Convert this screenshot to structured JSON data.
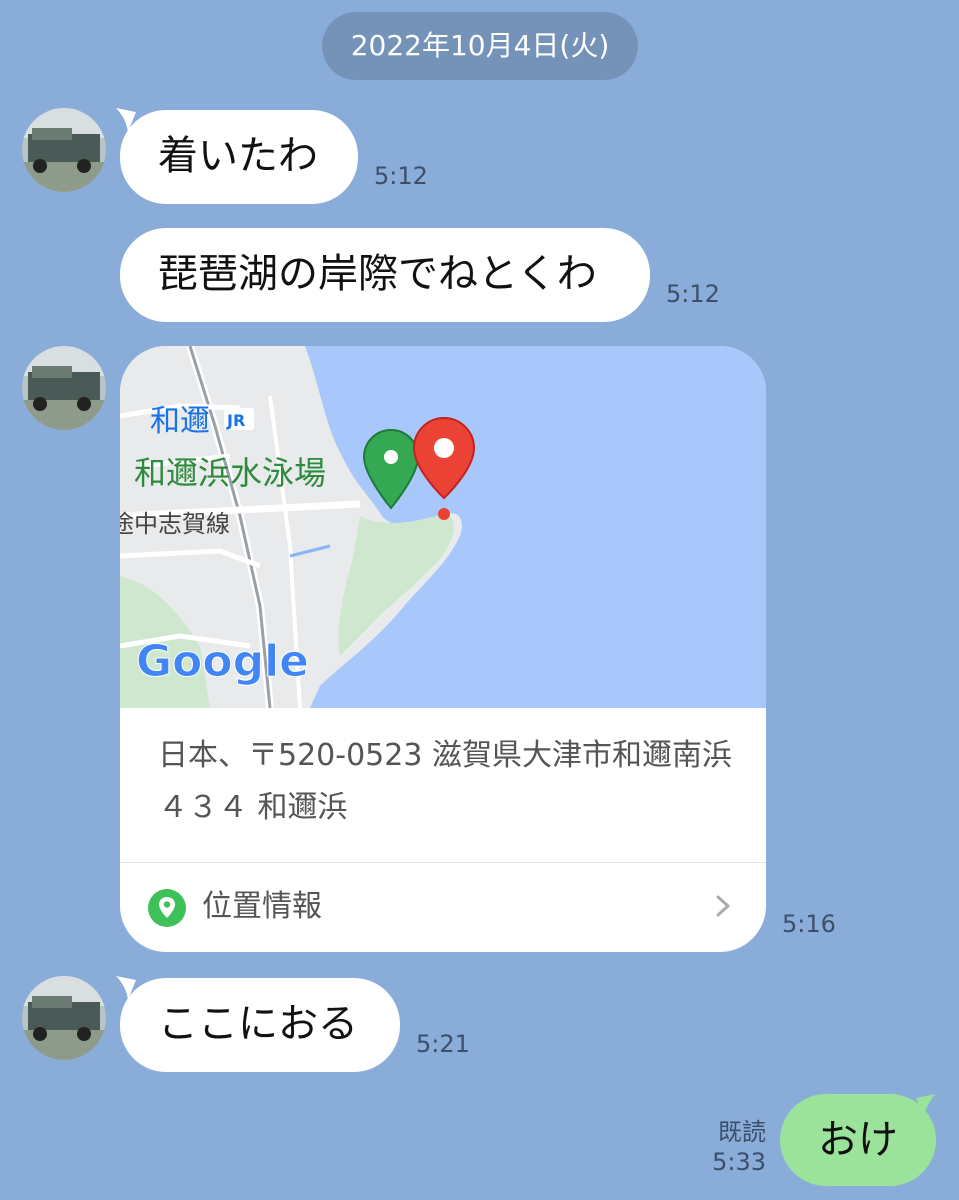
{
  "date_divider": "2022年10月4日(火)",
  "messages": [
    {
      "text": "着いたわ",
      "time": "5:12"
    },
    {
      "text": "琵琶湖の岸際でねとくわ",
      "time": "5:12"
    },
    {
      "time": "5:16"
    },
    {
      "text": "ここにおる",
      "time": "5:21"
    }
  ],
  "location_card": {
    "map_labels": {
      "station": "和邇",
      "jr_mark": "JR",
      "beach": "和邇浜水泳場",
      "road": "途中志賀線",
      "logo": "Google"
    },
    "address": "日本、〒520-0523 滋賀県大津市和邇南浜４３４ 和邇浜",
    "footer_label": "位置情報"
  },
  "my_message": {
    "text": "おけ",
    "read_label": "既読",
    "time": "5:33"
  },
  "colors": {
    "background": "#8aacd9",
    "my_bubble": "#9be39b",
    "accent_green": "#3ec05a",
    "pin_red": "#ef5350"
  }
}
